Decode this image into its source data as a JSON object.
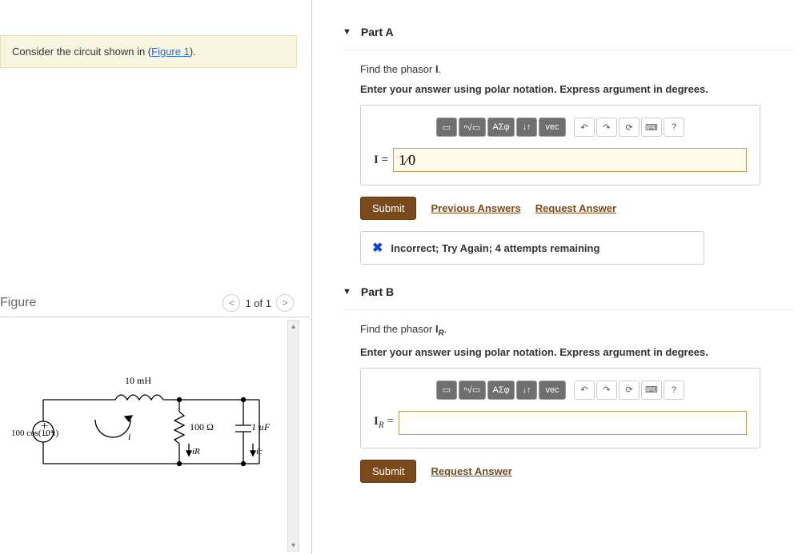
{
  "left": {
    "prompt_prefix": "Consider the circuit shown in (",
    "figure_link_text": "Figure 1",
    "prompt_suffix": ").",
    "figure_title": "Figure",
    "pager_text": "1 of 1"
  },
  "circuit": {
    "source_label": "100 cos(10⁴t)",
    "inductor_label": "10 mH",
    "loop_current": "i",
    "resistor_label": "100 Ω",
    "resistor_current": "iR",
    "capacitor_label": "1 µF",
    "capacitor_current": "ic"
  },
  "toolbar": {
    "tmpl": "▭",
    "sqrt": "ⁿ√▭",
    "greek": "ΑΣφ",
    "arrows": "↓↑",
    "vec": "vec",
    "undo": "↶",
    "redo": "↷",
    "reset": "⟳",
    "keyboard": "⌨",
    "help": "?"
  },
  "buttons": {
    "submit": "Submit",
    "previous_answers": "Previous Answers",
    "request_answer": "Request Answer"
  },
  "parts": {
    "a": {
      "title": "Part A",
      "prompt": "Find the phasor ",
      "prompt_sym": "I",
      "prompt_end": ".",
      "instruction": "Enter your answer using polar notation. Express argument in degrees.",
      "label": "I = ",
      "value": "1∕0",
      "feedback": "Incorrect; Try Again; 4 attempts remaining"
    },
    "b": {
      "title": "Part B",
      "prompt": "Find the phasor ",
      "prompt_sym": "I",
      "prompt_sub": "R",
      "prompt_end": ".",
      "instruction": "Enter your answer using polar notation. Express argument in degrees.",
      "label_html": "I<sub><i>R</i></sub> = ",
      "value": ""
    }
  }
}
